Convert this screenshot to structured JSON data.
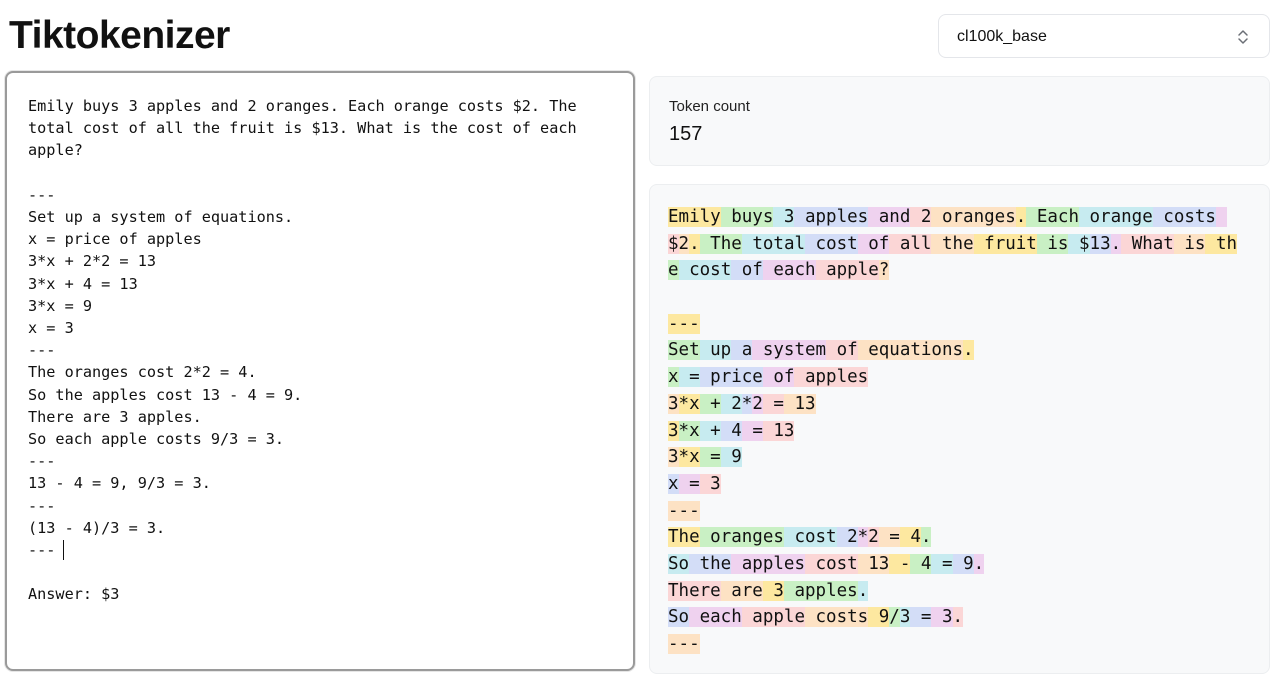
{
  "app": {
    "title": "Tiktokenizer"
  },
  "encoding_select": {
    "value": "cl100k_base",
    "icon": "chevron-updown-icon"
  },
  "editor": {
    "text": "Emily buys 3 apples and 2 oranges. Each orange costs $2. The\ntotal cost of all the fruit is $13. What is the cost of each\napple?\n\n---\nSet up a system of equations.\nx = price of apples\n3*x + 2*2 = 13\n3*x + 4 = 13\n3*x = 9\nx = 3\n---\nThe oranges cost 2*2 = 4.\nSo the apples cost 13 - 4 = 9.\nThere are 3 apples.\nSo each apple costs 9/3 = 3.\n---\n13 - 4 = 9, 9/3 = 3.\n---\n(13 - 4)/3 = 3.\n---\n\nAnswer: $3"
  },
  "token_count": {
    "label": "Token count",
    "value": "157"
  },
  "token_colors": [
    "#fde8a0",
    "#c9f0c4",
    "#c7ebf0",
    "#d3ddf7",
    "#efd2ef",
    "#fbd6d6",
    "#fde2c4"
  ],
  "token_lines": [
    [
      "Emily",
      " buys",
      " 3",
      " apples",
      " and",
      " 2",
      " oranges",
      ".",
      " Each",
      " orange",
      " costs",
      " "
    ],
    [
      "$",
      "2",
      ".",
      " The",
      " total",
      " cost",
      " of",
      " all",
      " the",
      " fruit",
      " is",
      " $",
      "13",
      ".",
      " What",
      " is",
      " th"
    ],
    [
      "e",
      " cost",
      " of",
      " each",
      " apple",
      "?"
    ],
    [],
    [
      "---"
    ],
    [
      "Set",
      " up",
      " a",
      " system",
      " of",
      " equations",
      "."
    ],
    [
      "x",
      " =",
      " price",
      " of",
      " apples"
    ],
    [
      "3",
      "*x",
      " +",
      " 2",
      "*",
      "2",
      " =",
      " 13"
    ],
    [
      "3",
      "*x",
      " +",
      " 4",
      " =",
      " 13"
    ],
    [
      "3",
      "*x",
      " =",
      " 9"
    ],
    [
      "x",
      " =",
      " 3"
    ],
    [
      "---"
    ],
    [
      "The",
      " oranges",
      " cost",
      " 2",
      "*",
      "2",
      " =",
      " 4",
      "."
    ],
    [
      "So",
      " the",
      " apples",
      " cost",
      " 13",
      " -",
      " 4",
      " =",
      " 9",
      "."
    ],
    [
      "There",
      " are",
      " 3",
      " apples",
      "."
    ],
    [
      "So",
      " each",
      " apple",
      " costs",
      " 9",
      "/",
      "3",
      " =",
      " 3",
      "."
    ],
    [
      "---"
    ]
  ]
}
